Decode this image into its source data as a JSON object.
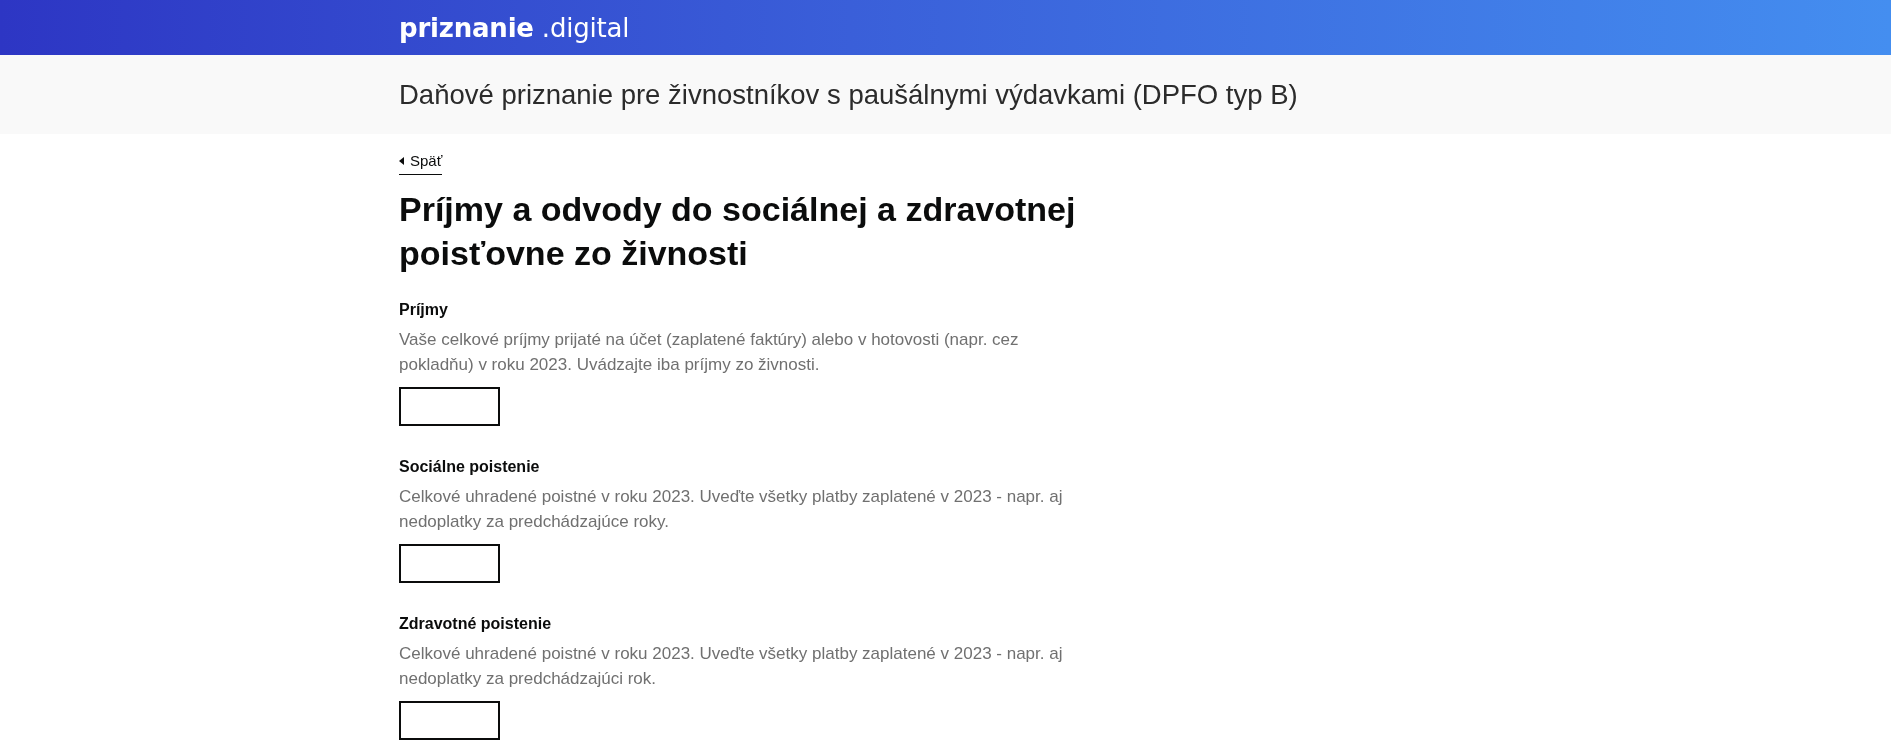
{
  "header": {
    "logo": "**priznanie** .digital"
  },
  "page_title": "Daňové priznanie pre živnostníkov s paušálnymi výdavkami (DPFO typ B)",
  "back_link": {
    "label": "Späť"
  },
  "heading": "Príjmy a odvody do sociálnej a zdravotnej poisťovne zo živnosti",
  "fields": [
    {
      "label": "Príjmy",
      "hint": "Vaše celkové príjmy prijaté na účet (zaplatené faktúry) alebo v hotovosti (napr. cez pokladňu) v roku 2023. Uvádzajte iba príjmy zo živnosti."
    },
    {
      "label": "Sociálne poistenie",
      "hint": "Celkové uhradené poistné v roku 2023. Uveďte všetky platby zaplatené v 2023 - napr. aj nedoplatky za predchádzajúce roky."
    },
    {
      "label": "Zdravotné poistenie",
      "hint": "Celkové uhradené poistné v roku 2023. Uveďte všetky platby zaplatené v 2023 - napr. aj nedoplatky za predchádzajúci rok."
    }
  ]
}
